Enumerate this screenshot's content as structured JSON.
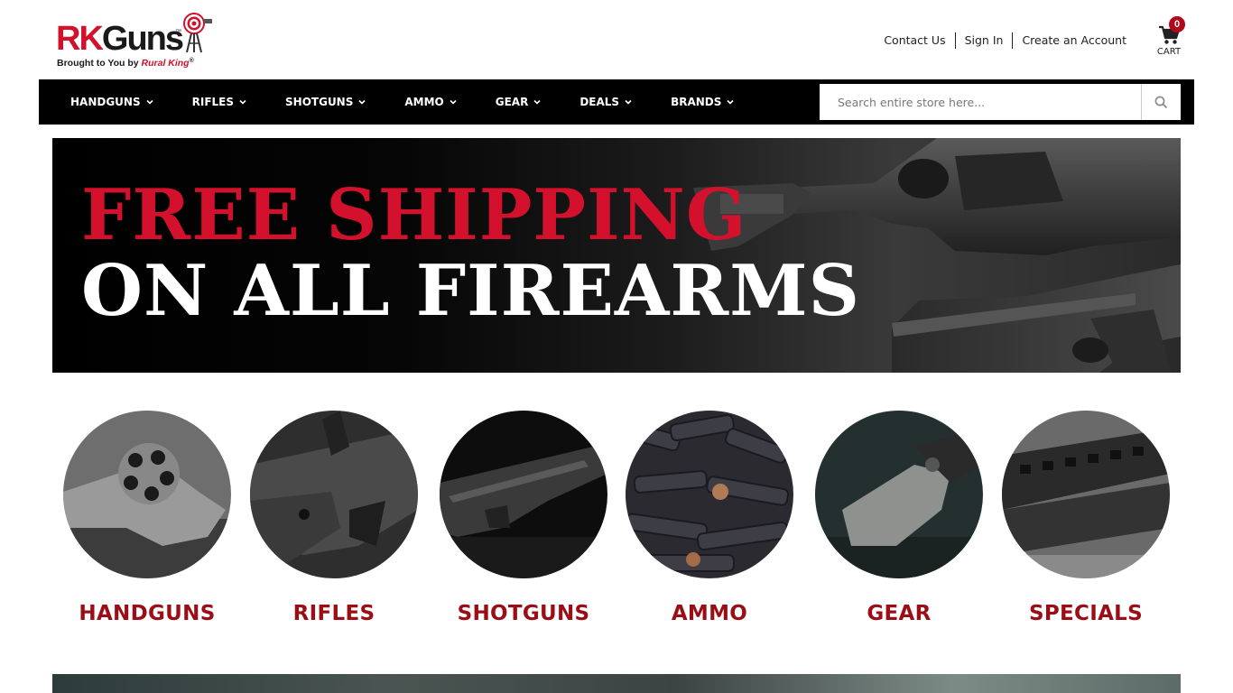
{
  "header": {
    "logo": {
      "rk": "RK",
      "guns": "Guns",
      "tm": "™",
      "tagline_prefix": "Brought to You by ",
      "tagline_brand": "Rural King",
      "tagline_tm": "®"
    },
    "links": {
      "contact": "Contact Us",
      "signin": "Sign In",
      "create": "Create an Account"
    },
    "cart": {
      "label": "CART",
      "count": "0"
    }
  },
  "nav": {
    "items": [
      {
        "label": "HANDGUNS"
      },
      {
        "label": "RIFLES"
      },
      {
        "label": "SHOTGUNS"
      },
      {
        "label": "AMMO"
      },
      {
        "label": "GEAR"
      },
      {
        "label": "DEALS"
      },
      {
        "label": "BRANDS"
      }
    ],
    "search": {
      "placeholder": "Search entire store here...",
      "value": ""
    }
  },
  "banner": {
    "line1": "FREE SHIPPING",
    "line2": "ON ALL FIREARMS"
  },
  "categories": [
    {
      "label": "HANDGUNS"
    },
    {
      "label": "RIFLES"
    },
    {
      "label": "SHOTGUNS"
    },
    {
      "label": "AMMO"
    },
    {
      "label": "GEAR"
    },
    {
      "label": "SPECIALS"
    }
  ],
  "colors": {
    "brand_red": "#d3112c",
    "category_red": "#9b0e16",
    "nav_bg": "#000000",
    "cart_badge": "#b0071a"
  }
}
